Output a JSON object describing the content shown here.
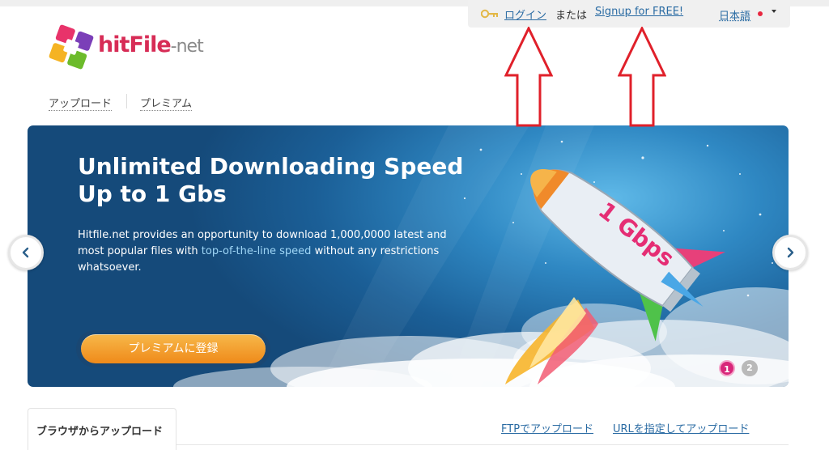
{
  "header": {
    "login_label": "ログイン",
    "or_label": "または",
    "signup_label": "Signup for FREE!",
    "language_label": "日本語"
  },
  "logo": {
    "name_hit": "hit",
    "name_file": "File",
    "name_dot": "-",
    "name_net": "net"
  },
  "nav": {
    "upload_label": "アップロード",
    "premium_label": "プレミアム"
  },
  "banner": {
    "title_line1": "Unlimited Downloading Speed",
    "title_line2": "Up to 1 Gbs",
    "desc_part1": "Hitfile.net provides an opportunity to download 1,000,0000 latest and most popular files with ",
    "desc_highlight": "top-of-the-line speed",
    "desc_part2": " without any restrictions whatsoever.",
    "rocket_label": "1 Gbps",
    "cta_label": "プレミアムに登録",
    "page_dots": [
      "1",
      "2"
    ],
    "active_page": 1
  },
  "upload_tabs": {
    "browser_tab": "ブラウザからアップロード",
    "ftp_tab": "FTPでアップロード",
    "url_tab": "URLを指定してアップロード"
  },
  "colors": {
    "link": "#2a6ba3",
    "brand": "#d72c56",
    "cta": "#ef8a1a",
    "banner_bg": "#1b5f97",
    "active_dot": "#d8267a",
    "annotation_arrow": "#e0202a"
  },
  "icons": {
    "key": "key-icon",
    "prev": "chevron-left-icon",
    "next": "chevron-right-icon",
    "dropdown": "caret-down-icon"
  }
}
